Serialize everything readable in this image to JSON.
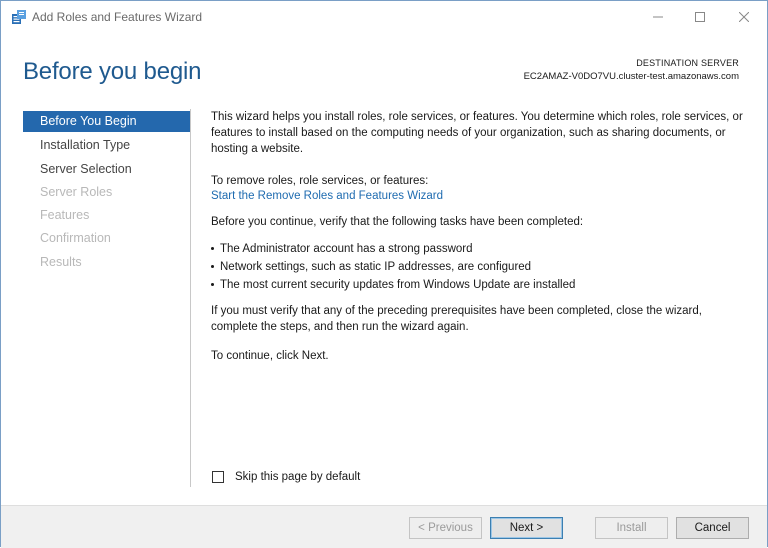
{
  "window": {
    "title": "Add Roles and Features Wizard",
    "icon": "server-manager-icon"
  },
  "header": {
    "page_title": "Before you begin",
    "destination_label": "DESTINATION SERVER",
    "destination_server": "EC2AMAZ-V0DO7VU.cluster-test.amazonaws.com"
  },
  "nav": {
    "items": [
      {
        "label": "Before You Begin",
        "state": "active"
      },
      {
        "label": "Installation Type",
        "state": "enabled"
      },
      {
        "label": "Server Selection",
        "state": "enabled"
      },
      {
        "label": "Server Roles",
        "state": "disabled"
      },
      {
        "label": "Features",
        "state": "disabled"
      },
      {
        "label": "Confirmation",
        "state": "disabled"
      },
      {
        "label": "Results",
        "state": "disabled"
      }
    ]
  },
  "content": {
    "intro": "This wizard helps you install roles, role services, or features. You determine which roles, role services, or features to install based on the computing needs of your organization, such as sharing documents, or hosting a website.",
    "remove_text": "To remove roles, role services, or features:",
    "remove_link": "Start the Remove Roles and Features Wizard",
    "before_continue": "Before you continue, verify that the following tasks have been completed:",
    "tasks": [
      "The Administrator account has a strong password",
      "Network settings, such as static IP addresses, are configured",
      "The most current security updates from Windows Update are installed"
    ],
    "verify": "If you must verify that any of the preceding prerequisites have been completed, close the wizard, complete the steps, and then run the wizard again.",
    "continue": "To continue, click Next."
  },
  "skip": {
    "label": "Skip this page by default",
    "checked": false
  },
  "footer": {
    "previous": "< Previous",
    "next": "Next >",
    "install": "Install",
    "cancel": "Cancel"
  },
  "colors": {
    "accent": "#2468ad",
    "title": "#1f5a8f",
    "link": "#1e6bb0"
  }
}
